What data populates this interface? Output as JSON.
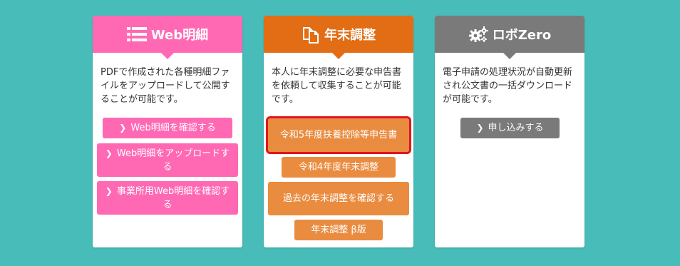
{
  "web_meisai": {
    "title": "Web明細",
    "color": "#ff69b4",
    "description": "PDFで作成された各種明細ファイルをアップロードして公開することが可能です。",
    "buttons": [
      "Web明細を確認する",
      "Web明細をアップロードする",
      "事業所用Web明細を確認する"
    ]
  },
  "nenmatsu": {
    "title": "年末調整",
    "color": "#e26d15",
    "description": "本人に年末調整に必要な申告書を依頼して収集することが可能です。",
    "buttons": [
      "令和5年度扶養控除等申告書",
      "令和4年度年末調整",
      "過去の年末調整を確認する",
      "年末調整 β版"
    ]
  },
  "robozero": {
    "title": "ロボZero",
    "color": "#7a7a7a",
    "description": "電子申請の処理状況が自動更新され公文書の一括ダウンロードが可能です。",
    "buttons": [
      "申し込みする"
    ]
  }
}
